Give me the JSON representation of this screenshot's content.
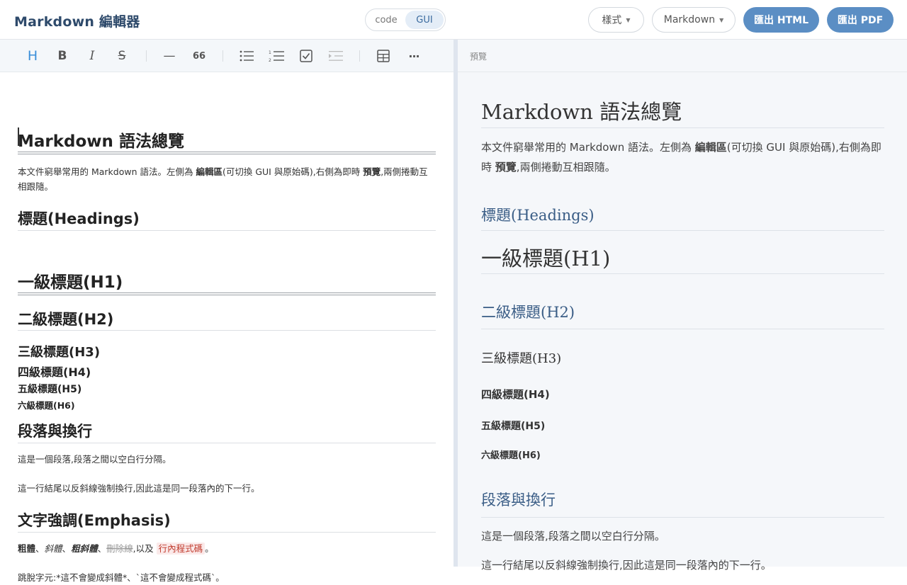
{
  "app": {
    "title": "Markdown 編輯器"
  },
  "mode": {
    "options": [
      "code",
      "GUI"
    ],
    "active": "GUI"
  },
  "header": {
    "style_label": "樣式",
    "format_label": "Markdown",
    "export_html": "匯出 HTML",
    "export_pdf": "匯出 PDF"
  },
  "toolbar": {
    "heading": "H",
    "bold": "B",
    "italic": "I",
    "strike": "S",
    "hr": "—",
    "quote": "66",
    "more": "···"
  },
  "preview_label": "預覽",
  "doc": {
    "title": "Markdown 語法總覽",
    "intro_a": "本文件窮舉常用的 Markdown 語法。左側為 ",
    "intro_b": "編輯區",
    "intro_c": "(可切換 GUI 與原始碼),右側為即時 ",
    "intro_d": "預覽",
    "intro_e": ",兩側捲動互相跟隨。",
    "headings_title": "標題(Headings)",
    "h1": "一級標題(H1)",
    "h2": "二級標題(H2)",
    "h3": "三級標題(H3)",
    "h4": "四級標題(H4)",
    "h5": "五級標題(H5)",
    "h6": "六級標題(H6)",
    "para_title": "段落與換行",
    "para1": "這是一個段落,段落之間以空白行分隔。",
    "para2": "這一行結尾以反斜線強制換行,因此這是同一段落內的下一行。",
    "emph_title": "文字強調(Emphasis)",
    "emph_bold": "粗體",
    "emph_sep1": "、",
    "emph_italic": "斜體",
    "emph_sep2": "、",
    "emph_bolditalic": "粗斜體",
    "emph_sep3": "、",
    "emph_strike": "刪除線",
    "emph_and": ",以及 ",
    "emph_code": "行內程式碼",
    "emph_end": "。",
    "escape_line": "跳脫字元:*這不會變成斜體*、`這不會變成程式碼`。"
  },
  "colors": {
    "accent": "#5b8ec4",
    "brand": "#2e4a6b",
    "preview_heading": "#3a5d86"
  }
}
